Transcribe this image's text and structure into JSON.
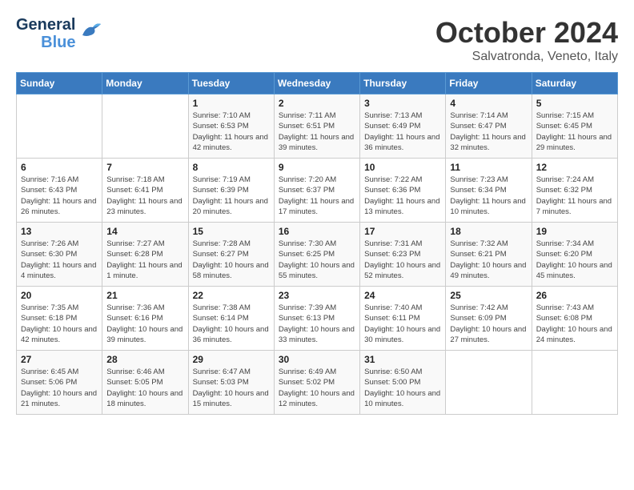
{
  "header": {
    "logo_general": "General",
    "logo_blue": "Blue",
    "month_title": "October 2024",
    "location": "Salvatronda, Veneto, Italy"
  },
  "days_of_week": [
    "Sunday",
    "Monday",
    "Tuesday",
    "Wednesday",
    "Thursday",
    "Friday",
    "Saturday"
  ],
  "weeks": [
    [
      {
        "day": "",
        "sunrise": "",
        "sunset": "",
        "daylight": ""
      },
      {
        "day": "",
        "sunrise": "",
        "sunset": "",
        "daylight": ""
      },
      {
        "day": "1",
        "sunrise": "Sunrise: 7:10 AM",
        "sunset": "Sunset: 6:53 PM",
        "daylight": "Daylight: 11 hours and 42 minutes."
      },
      {
        "day": "2",
        "sunrise": "Sunrise: 7:11 AM",
        "sunset": "Sunset: 6:51 PM",
        "daylight": "Daylight: 11 hours and 39 minutes."
      },
      {
        "day": "3",
        "sunrise": "Sunrise: 7:13 AM",
        "sunset": "Sunset: 6:49 PM",
        "daylight": "Daylight: 11 hours and 36 minutes."
      },
      {
        "day": "4",
        "sunrise": "Sunrise: 7:14 AM",
        "sunset": "Sunset: 6:47 PM",
        "daylight": "Daylight: 11 hours and 32 minutes."
      },
      {
        "day": "5",
        "sunrise": "Sunrise: 7:15 AM",
        "sunset": "Sunset: 6:45 PM",
        "daylight": "Daylight: 11 hours and 29 minutes."
      }
    ],
    [
      {
        "day": "6",
        "sunrise": "Sunrise: 7:16 AM",
        "sunset": "Sunset: 6:43 PM",
        "daylight": "Daylight: 11 hours and 26 minutes."
      },
      {
        "day": "7",
        "sunrise": "Sunrise: 7:18 AM",
        "sunset": "Sunset: 6:41 PM",
        "daylight": "Daylight: 11 hours and 23 minutes."
      },
      {
        "day": "8",
        "sunrise": "Sunrise: 7:19 AM",
        "sunset": "Sunset: 6:39 PM",
        "daylight": "Daylight: 11 hours and 20 minutes."
      },
      {
        "day": "9",
        "sunrise": "Sunrise: 7:20 AM",
        "sunset": "Sunset: 6:37 PM",
        "daylight": "Daylight: 11 hours and 17 minutes."
      },
      {
        "day": "10",
        "sunrise": "Sunrise: 7:22 AM",
        "sunset": "Sunset: 6:36 PM",
        "daylight": "Daylight: 11 hours and 13 minutes."
      },
      {
        "day": "11",
        "sunrise": "Sunrise: 7:23 AM",
        "sunset": "Sunset: 6:34 PM",
        "daylight": "Daylight: 11 hours and 10 minutes."
      },
      {
        "day": "12",
        "sunrise": "Sunrise: 7:24 AM",
        "sunset": "Sunset: 6:32 PM",
        "daylight": "Daylight: 11 hours and 7 minutes."
      }
    ],
    [
      {
        "day": "13",
        "sunrise": "Sunrise: 7:26 AM",
        "sunset": "Sunset: 6:30 PM",
        "daylight": "Daylight: 11 hours and 4 minutes."
      },
      {
        "day": "14",
        "sunrise": "Sunrise: 7:27 AM",
        "sunset": "Sunset: 6:28 PM",
        "daylight": "Daylight: 11 hours and 1 minute."
      },
      {
        "day": "15",
        "sunrise": "Sunrise: 7:28 AM",
        "sunset": "Sunset: 6:27 PM",
        "daylight": "Daylight: 10 hours and 58 minutes."
      },
      {
        "day": "16",
        "sunrise": "Sunrise: 7:30 AM",
        "sunset": "Sunset: 6:25 PM",
        "daylight": "Daylight: 10 hours and 55 minutes."
      },
      {
        "day": "17",
        "sunrise": "Sunrise: 7:31 AM",
        "sunset": "Sunset: 6:23 PM",
        "daylight": "Daylight: 10 hours and 52 minutes."
      },
      {
        "day": "18",
        "sunrise": "Sunrise: 7:32 AM",
        "sunset": "Sunset: 6:21 PM",
        "daylight": "Daylight: 10 hours and 49 minutes."
      },
      {
        "day": "19",
        "sunrise": "Sunrise: 7:34 AM",
        "sunset": "Sunset: 6:20 PM",
        "daylight": "Daylight: 10 hours and 45 minutes."
      }
    ],
    [
      {
        "day": "20",
        "sunrise": "Sunrise: 7:35 AM",
        "sunset": "Sunset: 6:18 PM",
        "daylight": "Daylight: 10 hours and 42 minutes."
      },
      {
        "day": "21",
        "sunrise": "Sunrise: 7:36 AM",
        "sunset": "Sunset: 6:16 PM",
        "daylight": "Daylight: 10 hours and 39 minutes."
      },
      {
        "day": "22",
        "sunrise": "Sunrise: 7:38 AM",
        "sunset": "Sunset: 6:14 PM",
        "daylight": "Daylight: 10 hours and 36 minutes."
      },
      {
        "day": "23",
        "sunrise": "Sunrise: 7:39 AM",
        "sunset": "Sunset: 6:13 PM",
        "daylight": "Daylight: 10 hours and 33 minutes."
      },
      {
        "day": "24",
        "sunrise": "Sunrise: 7:40 AM",
        "sunset": "Sunset: 6:11 PM",
        "daylight": "Daylight: 10 hours and 30 minutes."
      },
      {
        "day": "25",
        "sunrise": "Sunrise: 7:42 AM",
        "sunset": "Sunset: 6:09 PM",
        "daylight": "Daylight: 10 hours and 27 minutes."
      },
      {
        "day": "26",
        "sunrise": "Sunrise: 7:43 AM",
        "sunset": "Sunset: 6:08 PM",
        "daylight": "Daylight: 10 hours and 24 minutes."
      }
    ],
    [
      {
        "day": "27",
        "sunrise": "Sunrise: 6:45 AM",
        "sunset": "Sunset: 5:06 PM",
        "daylight": "Daylight: 10 hours and 21 minutes."
      },
      {
        "day": "28",
        "sunrise": "Sunrise: 6:46 AM",
        "sunset": "Sunset: 5:05 PM",
        "daylight": "Daylight: 10 hours and 18 minutes."
      },
      {
        "day": "29",
        "sunrise": "Sunrise: 6:47 AM",
        "sunset": "Sunset: 5:03 PM",
        "daylight": "Daylight: 10 hours and 15 minutes."
      },
      {
        "day": "30",
        "sunrise": "Sunrise: 6:49 AM",
        "sunset": "Sunset: 5:02 PM",
        "daylight": "Daylight: 10 hours and 12 minutes."
      },
      {
        "day": "31",
        "sunrise": "Sunrise: 6:50 AM",
        "sunset": "Sunset: 5:00 PM",
        "daylight": "Daylight: 10 hours and 10 minutes."
      },
      {
        "day": "",
        "sunrise": "",
        "sunset": "",
        "daylight": ""
      },
      {
        "day": "",
        "sunrise": "",
        "sunset": "",
        "daylight": ""
      }
    ]
  ]
}
